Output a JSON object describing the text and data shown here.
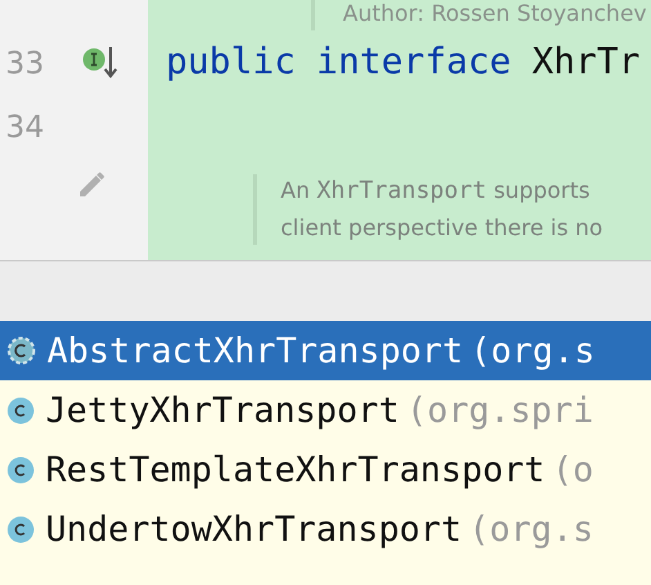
{
  "editor": {
    "author_line": "Author: Rossen Stoyanchev",
    "lines": [
      {
        "number": "33",
        "implemented": true,
        "tokens": [
          {
            "text": "public",
            "kind": "keyword"
          },
          {
            "text": "interface",
            "kind": "keyword"
          },
          {
            "text": "XhrTr",
            "kind": "name"
          }
        ]
      },
      {
        "number": "34",
        "implemented": false
      }
    ],
    "doc": [
      [
        {
          "text": "An ",
          "kind": "prose"
        },
        {
          "text": "XhrTransport",
          "kind": "code"
        },
        {
          "text": " supports",
          "kind": "prose"
        }
      ],
      [
        {
          "text": "client perspective there is no",
          "kind": "prose"
        }
      ]
    ]
  },
  "completion": {
    "items": [
      {
        "kind": "abstract_class",
        "name": "AbstractXhrTransport",
        "package": "(org.s",
        "selected": true
      },
      {
        "kind": "class",
        "name": "JettyXhrTransport",
        "package": "(org.spri",
        "selected": false
      },
      {
        "kind": "class",
        "name": "RestTemplateXhrTransport",
        "package": "(o",
        "selected": false
      },
      {
        "kind": "class",
        "name": "UndertowXhrTransport",
        "package": "(org.s",
        "selected": false
      }
    ]
  }
}
